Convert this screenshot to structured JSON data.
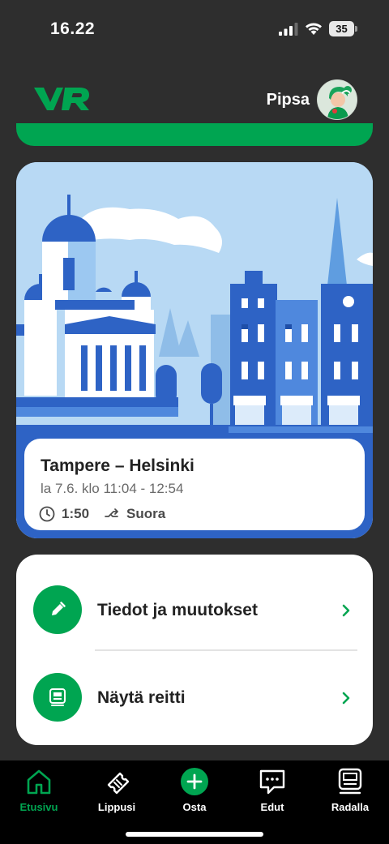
{
  "status_bar": {
    "time": "16.22",
    "battery": "35"
  },
  "header": {
    "logo": "VR",
    "user_name": "Pipsa"
  },
  "trip": {
    "route": "Tampere – Helsinki",
    "datetime": "la 7.6. klo 11:04 - 12:54",
    "duration": "1:50",
    "connection": "Suora"
  },
  "actions": [
    {
      "label": "Tiedot ja muutokset",
      "icon": "pencil-icon"
    },
    {
      "label": "Näytä reitti",
      "icon": "train-icon"
    }
  ],
  "nav": [
    {
      "label": "Etusivu",
      "icon": "home-icon",
      "active": true
    },
    {
      "label": "Lippusi",
      "icon": "ticket-icon",
      "active": false
    },
    {
      "label": "Osta",
      "icon": "plus-circle-icon",
      "active": false
    },
    {
      "label": "Edut",
      "icon": "chat-bubble-icon",
      "active": false
    },
    {
      "label": "Radalla",
      "icon": "train-icon",
      "active": false
    }
  ],
  "colors": {
    "brand_green": "#00a551",
    "background": "#2e2e2e",
    "nav_background": "#000000"
  }
}
